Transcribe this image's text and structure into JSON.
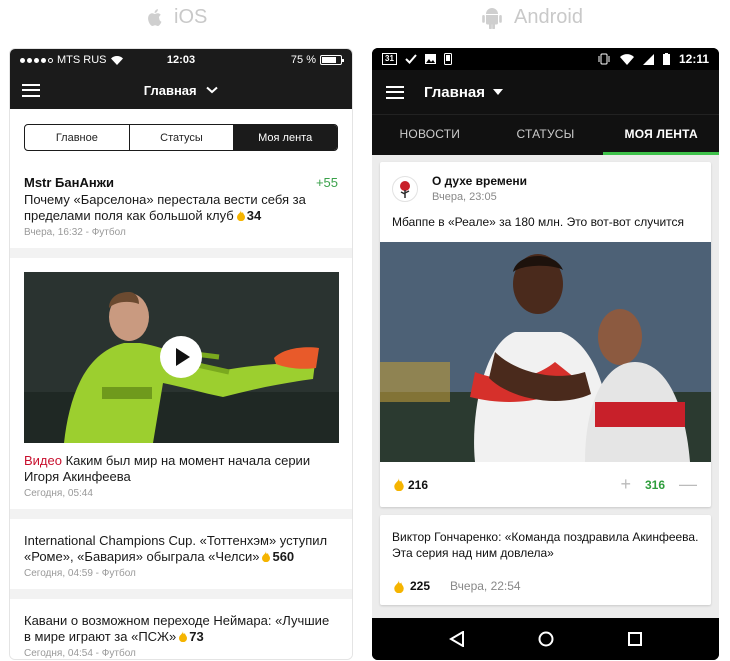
{
  "labels": {
    "ios": "iOS",
    "android": "Android"
  },
  "ios": {
    "status": {
      "carrier": "MTS RUS",
      "time": "12:03",
      "battery": "75 %"
    },
    "nav_title": "Главная",
    "segments": [
      "Главное",
      "Статусы",
      "Моя лента"
    ],
    "active_segment": 2,
    "feed": [
      {
        "author": "Mstr БанАнжи",
        "score": "+55",
        "text": "Почему «Барселона» перестала вести себя за пределами поля как большой клуб",
        "count": "34",
        "meta": "Вчера, 16:32 - Футбол"
      },
      {
        "tag": "Видео",
        "text": "Каким был мир на момент начала серии Игоря Акинфеева",
        "meta": "Сегодня, 05:44"
      },
      {
        "text": "International Champions Cup. «Тоттенхэм» уступил «Роме», «Бавария» обыграла «Челси»",
        "count": "560",
        "meta": "Сегодня, 04:59 - Футбол"
      },
      {
        "text": "Кавани о возможном переходе Неймара: «Лучшие в мире играют за «ПСЖ»",
        "count": "73",
        "meta": "Сегодня, 04:54 - Футбол"
      }
    ]
  },
  "android": {
    "status": {
      "time": "12:11",
      "date_icon": "31"
    },
    "appbar_title": "Главная",
    "tabs": [
      "НОВОСТИ",
      "СТАТУСЫ",
      "МОЯ ЛЕНТА"
    ],
    "active_tab": 2,
    "post": {
      "blog": "О духе времени",
      "date": "Вчера, 23:05",
      "text": "Мбаппе в «Реале» за 180 млн. Это вот-вот случится",
      "likes": "216",
      "score": "316",
      "plus": "+",
      "minus": "—"
    },
    "post2": {
      "text": "Виктор Гончаренко: «Команда поздравила Акинфеева. Эта серия над ним довлела»",
      "likes": "225",
      "date": "Вчера, 22:54"
    }
  },
  "colors": {
    "accent_green": "#3ec14a",
    "fire": "#f5b400",
    "video_tag": "#c8102e"
  },
  "icons": [
    "apple-icon",
    "android-icon",
    "hamburger-icon",
    "chevron-down-icon",
    "play-icon",
    "fire-icon",
    "back-icon",
    "home-icon",
    "recents-icon",
    "wifi-icon",
    "signal-icon",
    "vibrate-icon"
  ]
}
